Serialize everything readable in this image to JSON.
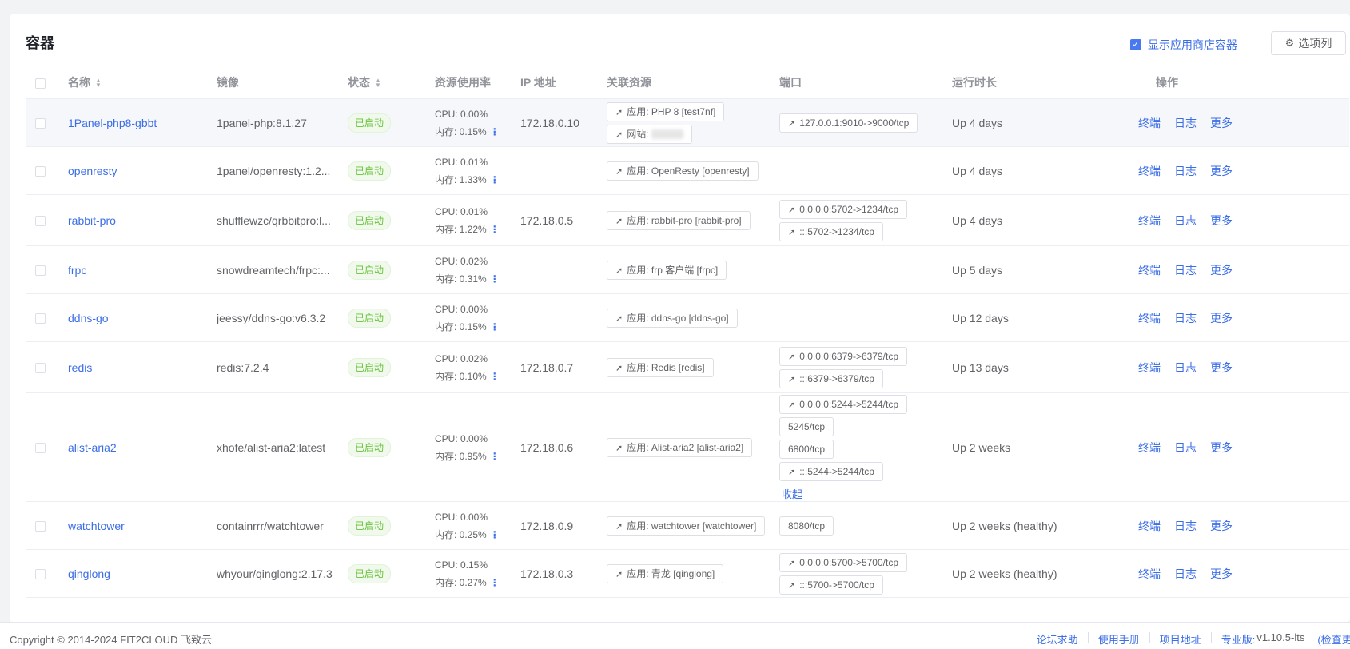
{
  "header": {
    "title": "容器",
    "show_store_label": "显示应用商店容器",
    "columns_button": "选项列"
  },
  "columns": [
    "名称",
    "镜像",
    "状态",
    "资源使用率",
    "IP 地址",
    "关联资源",
    "端口",
    "运行时长",
    "操作"
  ],
  "actions": {
    "terminal": "终端",
    "log": "日志",
    "more": "更多"
  },
  "collapse_label": "收起",
  "rows": [
    {
      "name": "1Panel-php8-gbbt",
      "image": "1panel-php:8.1.27",
      "status": "已启动",
      "cpu": "CPU: 0.00%",
      "mem": "内存: 0.15%",
      "ip": "172.18.0.10",
      "resources": [
        "应用: PHP 8 [test7nf]",
        "网站: "
      ],
      "ports": [
        "127.0.0.1:9010->9000/tcp"
      ],
      "uptime": "Up 4 days"
    },
    {
      "name": "openresty",
      "image": "1panel/openresty:1.2...",
      "status": "已启动",
      "cpu": "CPU: 0.01%",
      "mem": "内存: 1.33%",
      "ip": "",
      "resources": [
        "应用: OpenResty [openresty]"
      ],
      "ports": [],
      "uptime": "Up 4 days"
    },
    {
      "name": "rabbit-pro",
      "image": "shufflewzc/qrbbitpro:l...",
      "status": "已启动",
      "cpu": "CPU: 0.01%",
      "mem": "内存: 1.22%",
      "ip": "172.18.0.5",
      "resources": [
        "应用: rabbit-pro [rabbit-pro]"
      ],
      "ports": [
        "0.0.0.0:5702->1234/tcp",
        ":::5702->1234/tcp"
      ],
      "uptime": "Up 4 days"
    },
    {
      "name": "frpc",
      "image": "snowdreamtech/frpc:...",
      "status": "已启动",
      "cpu": "CPU: 0.02%",
      "mem": "内存: 0.31%",
      "ip": "",
      "resources": [
        "应用: frp 客户端 [frpc]"
      ],
      "ports": [],
      "uptime": "Up 5 days"
    },
    {
      "name": "ddns-go",
      "image": "jeessy/ddns-go:v6.3.2",
      "status": "已启动",
      "cpu": "CPU: 0.00%",
      "mem": "内存: 0.15%",
      "ip": "",
      "resources": [
        "应用: ddns-go [ddns-go]"
      ],
      "ports": [],
      "uptime": "Up 12 days"
    },
    {
      "name": "redis",
      "image": "redis:7.2.4",
      "status": "已启动",
      "cpu": "CPU: 0.02%",
      "mem": "内存: 0.10%",
      "ip": "172.18.0.7",
      "resources": [
        "应用: Redis [redis]"
      ],
      "ports": [
        "0.0.0.0:6379->6379/tcp",
        ":::6379->6379/tcp"
      ],
      "uptime": "Up 13 days"
    },
    {
      "name": "alist-aria2",
      "image": "xhofe/alist-aria2:latest",
      "status": "已启动",
      "cpu": "CPU: 0.00%",
      "mem": "内存: 0.95%",
      "ip": "172.18.0.6",
      "resources": [
        "应用: Alist-aria2 [alist-aria2]"
      ],
      "ports": [
        "0.0.0.0:5244->5244/tcp",
        "5245/tcp",
        "6800/tcp",
        ":::5244->5244/tcp"
      ],
      "uptime": "Up 2 weeks"
    },
    {
      "name": "watchtower",
      "image": "containrrr/watchtower",
      "status": "已启动",
      "cpu": "CPU: 0.00%",
      "mem": "内存: 0.25%",
      "ip": "172.18.0.9",
      "resources": [
        "应用: watchtower [watchtower]"
      ],
      "ports": [
        "8080/tcp"
      ],
      "uptime": "Up 2 weeks (healthy)"
    },
    {
      "name": "qinglong",
      "image": "whyour/qinglong:2.17.3",
      "status": "已启动",
      "cpu": "CPU: 0.15%",
      "mem": "内存: 0.27%",
      "ip": "172.18.0.3",
      "resources": [
        "应用: 青龙 [qinglong]"
      ],
      "ports": [
        "0.0.0.0:5700->5700/tcp",
        ":::5700->5700/tcp"
      ],
      "uptime": "Up 2 weeks (healthy)"
    }
  ],
  "footer": {
    "copyright": "Copyright © 2014-2024 FIT2CLOUD 飞致云",
    "forum": "论坛求助",
    "manual": "使用手册",
    "project": "项目地址",
    "edition_label": "专业版:",
    "version": "v1.10.5-lts",
    "check_update": "(检查更新)"
  }
}
